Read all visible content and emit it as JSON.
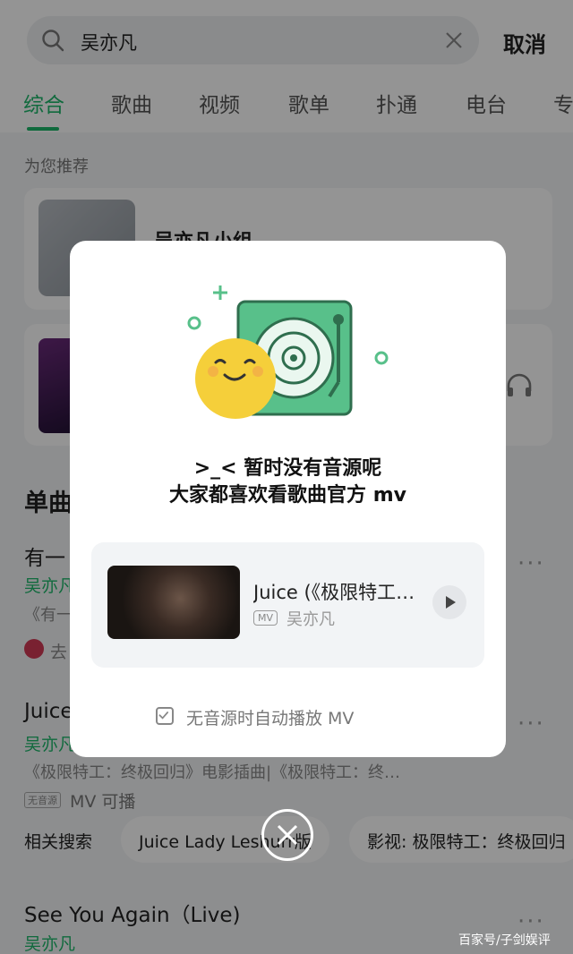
{
  "search": {
    "query": "吴亦凡",
    "cancel_label": "取消"
  },
  "tabs": [
    "综合",
    "歌曲",
    "视频",
    "歌单",
    "扑通",
    "电台",
    "专"
  ],
  "recommend": {
    "title": "为您推荐",
    "card1_title": "吴亦凡小组"
  },
  "singles": {
    "title": "单曲",
    "songs": [
      {
        "title": "有一",
        "artist": "吴亦凡",
        "desc": "《有一",
        "extra": "去"
      },
      {
        "title": "Juice",
        "artist": "吴亦凡",
        "desc": "《极限特工：终极回归》电影插曲|《极限特工：终…",
        "badge": "无音源",
        "mv": "MV 可播"
      },
      {
        "title": "See You Again（Live)",
        "artist": "吴亦凡"
      }
    ]
  },
  "related": {
    "label": "相关搜索",
    "chips": [
      "Juice Lady Leshurr版",
      "影视: 极限特工：终极回归"
    ]
  },
  "dialog": {
    "line1": ">_< 暂时没有音源呢",
    "line2": "大家都喜欢看歌曲官方 mv",
    "mv_title": "Juice (《极限特工：终极回归》",
    "mv_tag": "MV",
    "mv_artist": "吴亦凡",
    "auto_play_label": "无音源时自动播放 MV"
  },
  "watermark": "百家号/子剑娱评",
  "colors": {
    "accent": "#1db76a",
    "record": "#58c08a",
    "smiley": "#f5cf3a"
  }
}
